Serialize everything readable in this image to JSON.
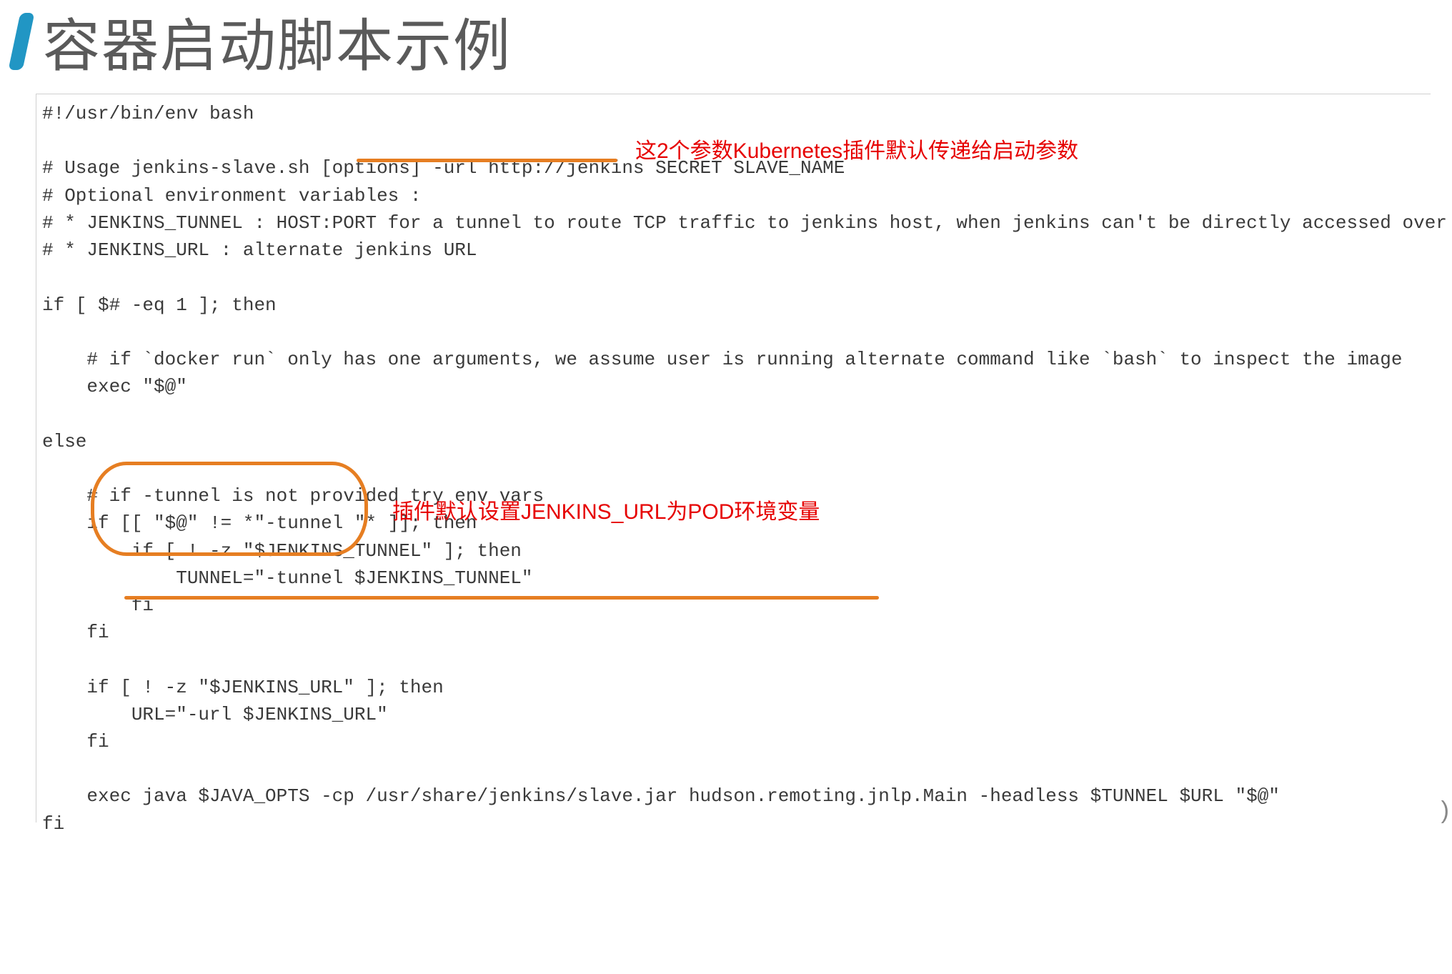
{
  "title": "容器启动脚本示例",
  "annotations": {
    "a1": "这2个参数Kubernetes插件默认传递给启动参数",
    "a2": "插件默认设置JENKINS_URL为POD环境变量"
  },
  "code": {
    "l1": "#!/usr/bin/env bash",
    "l2": "",
    "l3": "# Usage jenkins-slave.sh [options] -url http://jenkins SECRET SLAVE_NAME",
    "l4": "# Optional environment variables :",
    "l5": "# * JENKINS_TUNNEL : HOST:PORT for a tunnel to route TCP traffic to jenkins host, when jenkins can't be directly accessed over network",
    "l6": "# * JENKINS_URL : alternate jenkins URL",
    "l7": "",
    "l8": "if [ $# -eq 1 ]; then",
    "l9": "",
    "l10": "    # if `docker run` only has one arguments, we assume user is running alternate command like `bash` to inspect the image",
    "l11": "    exec \"$@\"",
    "l12": "",
    "l13": "else",
    "l14": "",
    "l15": "    # if -tunnel is not provided try env vars",
    "l16": "    if [[ \"$@\" != *\"-tunnel \"* ]]; then",
    "l17": "        if [ ! -z \"$JENKINS_TUNNEL\" ]; then",
    "l18": "            TUNNEL=\"-tunnel $JENKINS_TUNNEL\"",
    "l19": "        fi",
    "l20": "    fi",
    "l21": "",
    "l22": "    if [ ! -z \"$JENKINS_URL\" ]; then",
    "l23": "        URL=\"-url $JENKINS_URL\"",
    "l24": "    fi",
    "l25": "",
    "l26": "    exec java $JAVA_OPTS -cp /usr/share/jenkins/slave.jar hudson.remoting.jnlp.Main -headless $TUNNEL $URL \"$@\"",
    "l27": "fi"
  }
}
